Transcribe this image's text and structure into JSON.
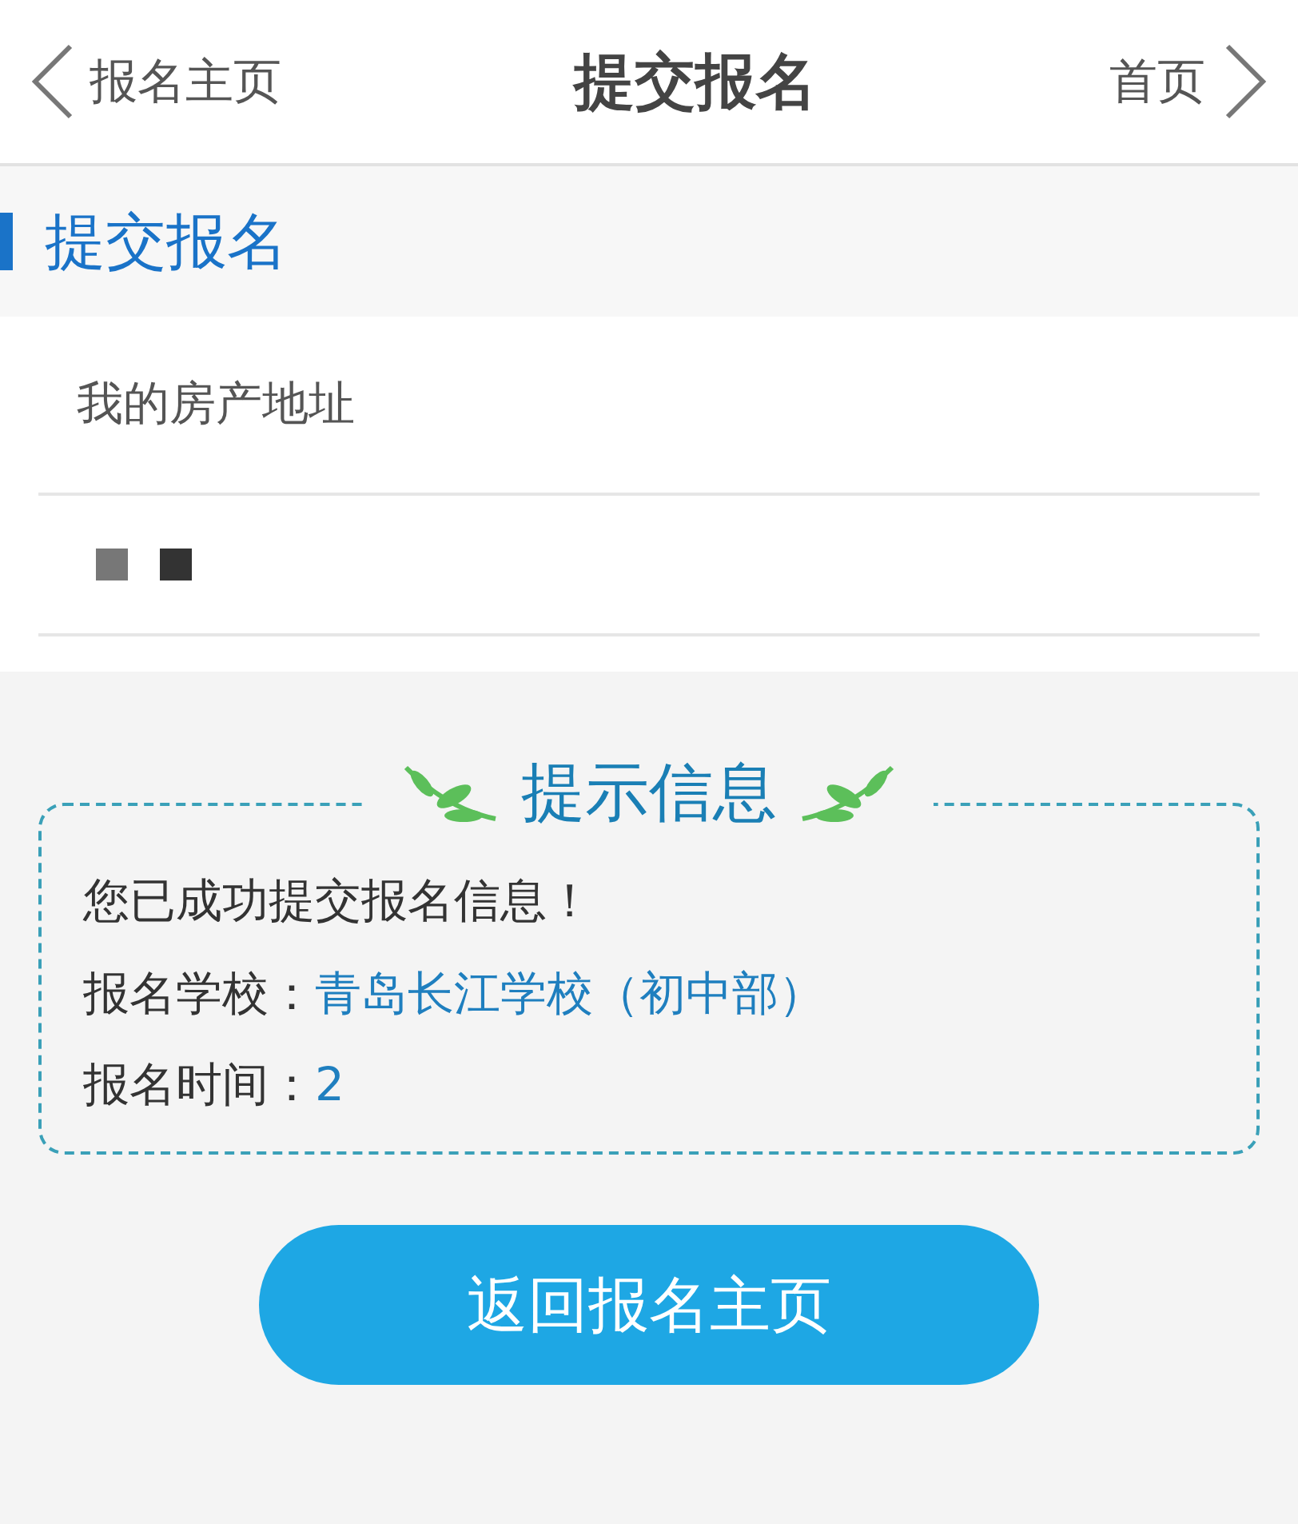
{
  "header": {
    "back_label": "报名主页",
    "title": "提交报名",
    "home_label": "首页"
  },
  "section": {
    "title": "提交报名"
  },
  "form": {
    "fields": [
      {
        "label": "我的房产地址"
      },
      {
        "redacted": true
      }
    ]
  },
  "tip": {
    "title": "提示信息",
    "message": "您已成功提交报名信息！",
    "rows": [
      {
        "label": "报名学校：",
        "value": "青岛长江学校（初中部）"
      },
      {
        "label": "报名时间：",
        "value": "2"
      }
    ]
  },
  "button": {
    "label": "返回报名主页"
  }
}
